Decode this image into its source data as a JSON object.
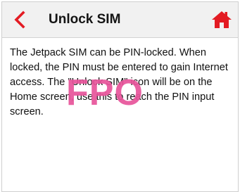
{
  "header": {
    "title": "Unlock SIM",
    "back_icon": "chevron-left-icon",
    "home_icon": "home-icon",
    "accent_color": "#e31b23"
  },
  "body": {
    "paragraph": "The Jetpack SIM can be PIN-locked. When locked, the PIN must be entered to gain Internet access. The \"Unlock SIM\" icon will be on the Home screen, use this to reach the PIN input screen."
  },
  "placeholder": {
    "watermark": "FPO",
    "color": "#e8549b"
  }
}
